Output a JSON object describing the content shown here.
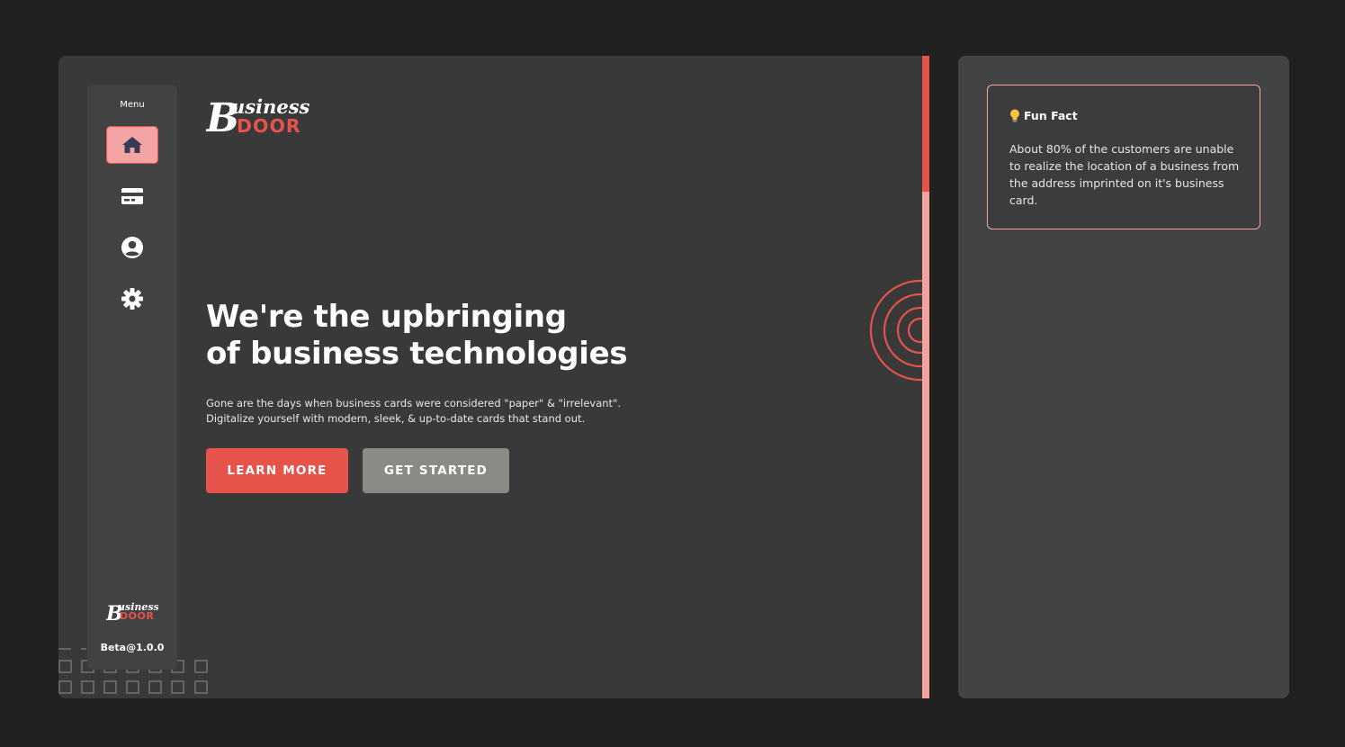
{
  "sidebar": {
    "menu_label": "Menu",
    "items": [
      {
        "name": "home",
        "icon": "home-icon",
        "active": true
      },
      {
        "name": "cards",
        "icon": "credit-card-icon",
        "active": false
      },
      {
        "name": "profile",
        "icon": "user-circle-icon",
        "active": false
      },
      {
        "name": "settings",
        "icon": "gear-icon",
        "active": false
      }
    ],
    "logo_top": "usiness",
    "logo_initial": "B",
    "logo_bottom": "DOOR",
    "version": "Beta@1.0.0"
  },
  "brand": {
    "logo_initial": "B",
    "logo_top": "usiness",
    "logo_bottom": "DOOR"
  },
  "hero": {
    "title_line1": "We're the upbringing",
    "title_line2": "of business technologies",
    "desc_line1": "Gone are the days when business cards were considered \"paper\" & \"irrelevant\".",
    "desc_line2": "Digitalize yourself with modern, sleek, & up-to-date cards that stand out.",
    "primary_button": "LEARN MORE",
    "secondary_button": "GET STARTED"
  },
  "fun_fact": {
    "icon": "lightbulb-icon",
    "title": "Fun Fact",
    "text": "About 80% of the customers are unable to realize the location of a business from the address imprinted on it's business card."
  },
  "colors": {
    "accent": "#e5534b",
    "accent_light": "#f4a4a4",
    "panel": "#393939",
    "side_panel": "#434343",
    "background": "#202020",
    "secondary_button": "#8b8a87"
  }
}
